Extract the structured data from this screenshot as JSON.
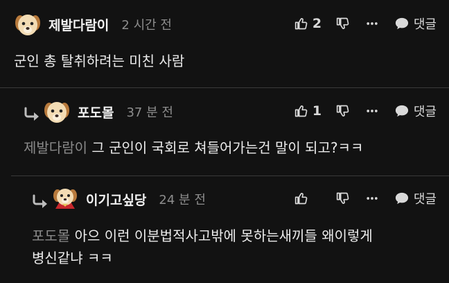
{
  "comments": [
    {
      "nickname": "제발다람이",
      "time": "2 시간 전",
      "likes": "2",
      "reply_label": "댓글",
      "mention": "",
      "text": "군인 총 탈취하려는 미친 사람",
      "avatar": "puppy"
    },
    {
      "nickname": "포도몰",
      "time": "37 분 전",
      "likes": "1",
      "reply_label": "댓글",
      "mention": "제발다람이",
      "text": "그 군인이 국회로 쳐들어가는건 말이 되고?ㅋㅋ",
      "avatar": "puppy"
    },
    {
      "nickname": "이기고싶당",
      "time": "24 분 전",
      "likes": "",
      "reply_label": "댓글",
      "mention": "포도몰",
      "text_line1": "아으 이런 이분법적사고밖에 못하는새끼들 왜이렇게",
      "text_line2": "병신같냐 ㅋㅋ",
      "avatar": "puppy-red-cape"
    }
  ],
  "colors": {
    "background": "#121212",
    "divider": "#3a3a3a",
    "mention": "#8a8a8a",
    "icon": "#d9d9d9"
  }
}
